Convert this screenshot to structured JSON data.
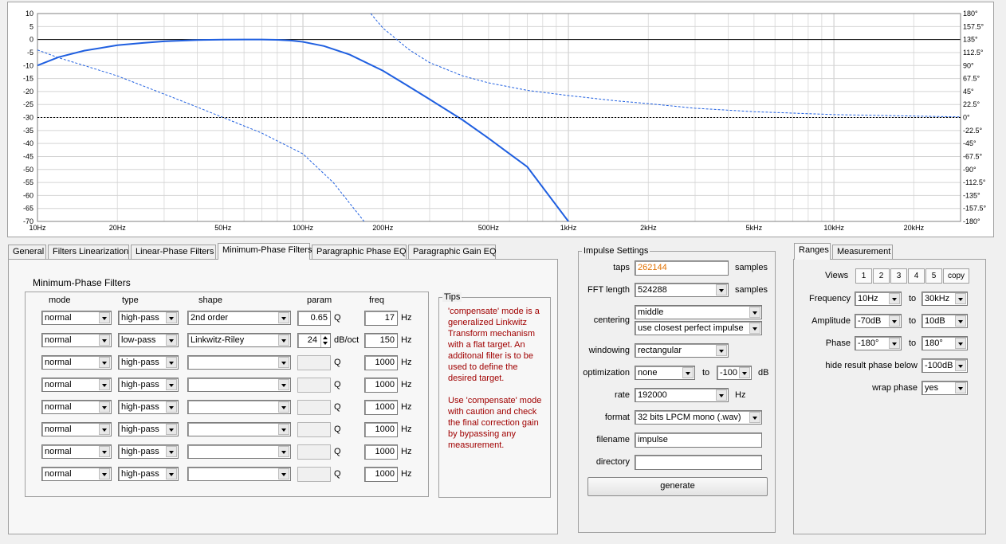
{
  "chart_data": {
    "type": "line",
    "x_scale": "log",
    "xlim": [
      10,
      30000
    ],
    "ylim": [
      -70,
      10
    ],
    "y2lim": [
      -180,
      180
    ],
    "grid": true,
    "x_ticks": [
      "10Hz",
      "20Hz",
      "50Hz",
      "100Hz",
      "200Hz",
      "500Hz",
      "1kHz",
      "2kHz",
      "5kHz",
      "10kHz",
      "20kHz"
    ],
    "y_ticks": [
      "10",
      "5",
      "0",
      "-5",
      "-10",
      "-15",
      "-20",
      "-25",
      "-30",
      "-35",
      "-40",
      "-45",
      "-50",
      "-55",
      "-60",
      "-65",
      "-70"
    ],
    "y2_ticks": [
      "180°",
      "157.5°",
      "135°",
      "112.5°",
      "90°",
      "67.5°",
      "45°",
      "22.5°",
      "0°",
      "-22.5°",
      "-45°",
      "-67.5°",
      "-90°",
      "-112.5°",
      "-135°",
      "-157.5°",
      "-180°"
    ],
    "series": [
      {
        "style": "solid",
        "x": [
          10,
          12,
          15,
          20,
          25,
          30,
          40,
          50,
          60,
          70,
          80,
          90,
          100,
          120,
          150,
          200,
          250,
          300,
          400,
          500,
          700,
          1000
        ],
        "y": [
          -10,
          -6.8,
          -4.3,
          -2.2,
          -1.3,
          -0.7,
          -0.2,
          -0.05,
          0,
          0,
          -0.1,
          -0.4,
          -0.9,
          -2.5,
          -5.8,
          -12,
          -18,
          -23,
          -31,
          -38,
          -49,
          -70
        ]
      },
      {
        "style": "dashed",
        "x": [
          10,
          12,
          15,
          20,
          30,
          40,
          50,
          70,
          100,
          130,
          170
        ],
        "y": [
          -4,
          -7,
          -10,
          -14,
          -21,
          -26,
          -30,
          -36,
          -44,
          -55,
          -70
        ]
      },
      {
        "style": "dashed",
        "axis": "right",
        "x": [
          180,
          200,
          250,
          300,
          400,
          500,
          700,
          1000,
          1500,
          2000,
          3000,
          5000,
          10000,
          30000
        ],
        "y": [
          180,
          155,
          118,
          95,
          72,
          60,
          47,
          38,
          29,
          24,
          16,
          10,
          5,
          1
        ]
      },
      {
        "style": "dashed-black",
        "axis": "right",
        "x": [
          10,
          30000
        ],
        "y": [
          0,
          0
        ]
      }
    ]
  },
  "tabs": [
    "General",
    "Filters Linearization",
    "Linear-Phase Filters",
    "Minimum-Phase Filters",
    "Paragraphic Phase EQ",
    "Paragraphic Gain EQ"
  ],
  "active_tab": "Minimum-Phase Filters",
  "mpf": {
    "title": "Minimum-Phase Filters",
    "headers": {
      "mode": "mode",
      "type": "type",
      "shape": "shape",
      "param": "param",
      "freq": "freq"
    },
    "rows": [
      {
        "mode": "normal",
        "type": "high-pass",
        "shape": "2nd order",
        "param": "0.65",
        "param_unit": "Q",
        "freq": "17",
        "freq_unit": "Hz"
      },
      {
        "mode": "normal",
        "type": "low-pass",
        "shape": "Linkwitz-Riley",
        "param": "24",
        "param_unit": "dB/oct",
        "freq": "150",
        "freq_unit": "Hz"
      },
      {
        "mode": "normal",
        "type": "high-pass",
        "shape": "",
        "param": "",
        "param_unit": "Q",
        "freq": "1000",
        "freq_unit": "Hz"
      },
      {
        "mode": "normal",
        "type": "high-pass",
        "shape": "",
        "param": "",
        "param_unit": "Q",
        "freq": "1000",
        "freq_unit": "Hz"
      },
      {
        "mode": "normal",
        "type": "high-pass",
        "shape": "",
        "param": "",
        "param_unit": "Q",
        "freq": "1000",
        "freq_unit": "Hz"
      },
      {
        "mode": "normal",
        "type": "high-pass",
        "shape": "",
        "param": "",
        "param_unit": "Q",
        "freq": "1000",
        "freq_unit": "Hz"
      },
      {
        "mode": "normal",
        "type": "high-pass",
        "shape": "",
        "param": "",
        "param_unit": "Q",
        "freq": "1000",
        "freq_unit": "Hz"
      },
      {
        "mode": "normal",
        "type": "high-pass",
        "shape": "",
        "param": "",
        "param_unit": "Q",
        "freq": "1000",
        "freq_unit": "Hz"
      }
    ]
  },
  "tips": {
    "title": "Tips",
    "lines": [
      "'compensate' mode is a",
      "generalized Linkwitz",
      "Transform mechanism",
      "with a flat target. An",
      "additonal filter is to be",
      "used to define the",
      "desired target.",
      "",
      "Use 'compensate' mode",
      "with caution and check",
      "the final correction gain",
      "by bypassing any",
      "measurement."
    ]
  },
  "impulse": {
    "title": "Impulse Settings",
    "taps_label": "taps",
    "taps_value": "262144",
    "taps_unit": "samples",
    "fft_label": "FFT length",
    "fft_value": "524288",
    "fft_unit": "samples",
    "centering_label": "centering",
    "centering_value": "middle",
    "centering_value2": "use closest perfect impulse",
    "windowing_label": "windowing",
    "windowing_value": "rectangular",
    "optimization_label": "optimization",
    "optimization_value": "none",
    "optimization_to": "to",
    "optimization_db": "-100",
    "optimization_unit": "dB",
    "rate_label": "rate",
    "rate_value": "192000",
    "rate_unit": "Hz",
    "format_label": "format",
    "format_value": "32 bits LPCM mono (.wav)",
    "filename_label": "filename",
    "filename_value": "impulse",
    "directory_label": "directory",
    "directory_value": "",
    "generate_label": "generate",
    "taps_color": "#e07000"
  },
  "right_tabs": [
    "Ranges",
    "Measurement"
  ],
  "ranges": {
    "views_label": "Views",
    "views": [
      "1",
      "2",
      "3",
      "4",
      "5"
    ],
    "copy_label": "copy",
    "frequency_label": "Frequency",
    "frequency_from": "10Hz",
    "frequency_to": "30kHz",
    "amplitude_label": "Amplitude",
    "amplitude_from": "-70dB",
    "amplitude_to": "10dB",
    "phase_label": "Phase",
    "phase_from": "-180°",
    "phase_to": "180°",
    "to_label": "to",
    "hide_label": "hide result phase below",
    "hide_value": "-100dB",
    "wrap_label": "wrap phase",
    "wrap_value": "yes"
  }
}
